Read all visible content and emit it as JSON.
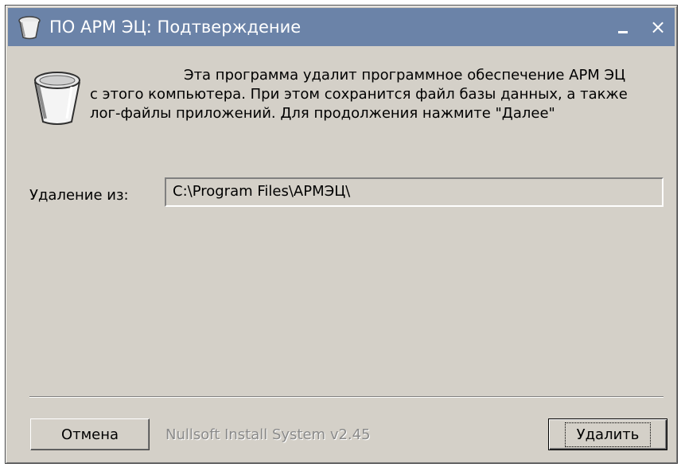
{
  "window": {
    "title": "ПО АРМ ЭЦ: Подтверждение",
    "minimize_label": "_",
    "close_label": "×"
  },
  "message": {
    "line1": "Эта программа удалит программное обеспечение АРМ ЭЦ",
    "line2": "с этого компьютера. При этом сохранится файл базы данных, а также",
    "line3": "лог-файлы приложений. Для продолжения нажмите \"Далее\""
  },
  "uninstall_from": {
    "label": "Удаление из:",
    "value": "C:\\Program Files\\АРМЭЦ\\"
  },
  "footer": {
    "cancel_label": "Отмена",
    "branding": "Nullsoft Install System v2.45",
    "remove_label_pre": "У",
    "remove_label_accel": "д",
    "remove_label_post": "алить"
  },
  "icons": {
    "app": "trash-icon",
    "main": "trash-icon"
  },
  "colors": {
    "titlebar": "#6b83a8",
    "dialog_face": "#d4d0c8",
    "branding_text": "#8a8a8a"
  }
}
